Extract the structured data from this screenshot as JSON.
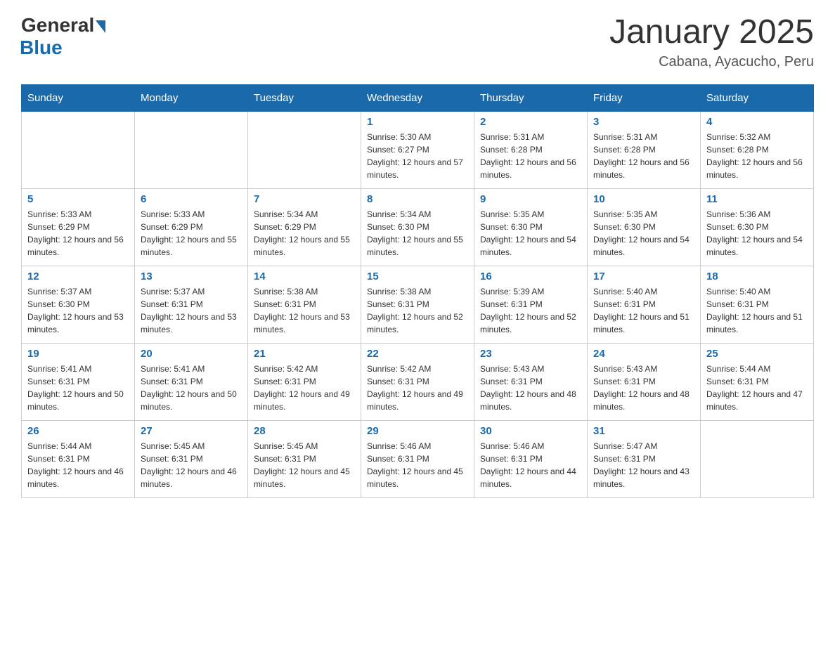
{
  "logo": {
    "general": "General",
    "blue": "Blue"
  },
  "title": "January 2025",
  "subtitle": "Cabana, Ayacucho, Peru",
  "days_of_week": [
    "Sunday",
    "Monday",
    "Tuesday",
    "Wednesday",
    "Thursday",
    "Friday",
    "Saturday"
  ],
  "weeks": [
    [
      {
        "day": "",
        "info": ""
      },
      {
        "day": "",
        "info": ""
      },
      {
        "day": "",
        "info": ""
      },
      {
        "day": "1",
        "info": "Sunrise: 5:30 AM\nSunset: 6:27 PM\nDaylight: 12 hours and 57 minutes."
      },
      {
        "day": "2",
        "info": "Sunrise: 5:31 AM\nSunset: 6:28 PM\nDaylight: 12 hours and 56 minutes."
      },
      {
        "day": "3",
        "info": "Sunrise: 5:31 AM\nSunset: 6:28 PM\nDaylight: 12 hours and 56 minutes."
      },
      {
        "day": "4",
        "info": "Sunrise: 5:32 AM\nSunset: 6:28 PM\nDaylight: 12 hours and 56 minutes."
      }
    ],
    [
      {
        "day": "5",
        "info": "Sunrise: 5:33 AM\nSunset: 6:29 PM\nDaylight: 12 hours and 56 minutes."
      },
      {
        "day": "6",
        "info": "Sunrise: 5:33 AM\nSunset: 6:29 PM\nDaylight: 12 hours and 55 minutes."
      },
      {
        "day": "7",
        "info": "Sunrise: 5:34 AM\nSunset: 6:29 PM\nDaylight: 12 hours and 55 minutes."
      },
      {
        "day": "8",
        "info": "Sunrise: 5:34 AM\nSunset: 6:30 PM\nDaylight: 12 hours and 55 minutes."
      },
      {
        "day": "9",
        "info": "Sunrise: 5:35 AM\nSunset: 6:30 PM\nDaylight: 12 hours and 54 minutes."
      },
      {
        "day": "10",
        "info": "Sunrise: 5:35 AM\nSunset: 6:30 PM\nDaylight: 12 hours and 54 minutes."
      },
      {
        "day": "11",
        "info": "Sunrise: 5:36 AM\nSunset: 6:30 PM\nDaylight: 12 hours and 54 minutes."
      }
    ],
    [
      {
        "day": "12",
        "info": "Sunrise: 5:37 AM\nSunset: 6:30 PM\nDaylight: 12 hours and 53 minutes."
      },
      {
        "day": "13",
        "info": "Sunrise: 5:37 AM\nSunset: 6:31 PM\nDaylight: 12 hours and 53 minutes."
      },
      {
        "day": "14",
        "info": "Sunrise: 5:38 AM\nSunset: 6:31 PM\nDaylight: 12 hours and 53 minutes."
      },
      {
        "day": "15",
        "info": "Sunrise: 5:38 AM\nSunset: 6:31 PM\nDaylight: 12 hours and 52 minutes."
      },
      {
        "day": "16",
        "info": "Sunrise: 5:39 AM\nSunset: 6:31 PM\nDaylight: 12 hours and 52 minutes."
      },
      {
        "day": "17",
        "info": "Sunrise: 5:40 AM\nSunset: 6:31 PM\nDaylight: 12 hours and 51 minutes."
      },
      {
        "day": "18",
        "info": "Sunrise: 5:40 AM\nSunset: 6:31 PM\nDaylight: 12 hours and 51 minutes."
      }
    ],
    [
      {
        "day": "19",
        "info": "Sunrise: 5:41 AM\nSunset: 6:31 PM\nDaylight: 12 hours and 50 minutes."
      },
      {
        "day": "20",
        "info": "Sunrise: 5:41 AM\nSunset: 6:31 PM\nDaylight: 12 hours and 50 minutes."
      },
      {
        "day": "21",
        "info": "Sunrise: 5:42 AM\nSunset: 6:31 PM\nDaylight: 12 hours and 49 minutes."
      },
      {
        "day": "22",
        "info": "Sunrise: 5:42 AM\nSunset: 6:31 PM\nDaylight: 12 hours and 49 minutes."
      },
      {
        "day": "23",
        "info": "Sunrise: 5:43 AM\nSunset: 6:31 PM\nDaylight: 12 hours and 48 minutes."
      },
      {
        "day": "24",
        "info": "Sunrise: 5:43 AM\nSunset: 6:31 PM\nDaylight: 12 hours and 48 minutes."
      },
      {
        "day": "25",
        "info": "Sunrise: 5:44 AM\nSunset: 6:31 PM\nDaylight: 12 hours and 47 minutes."
      }
    ],
    [
      {
        "day": "26",
        "info": "Sunrise: 5:44 AM\nSunset: 6:31 PM\nDaylight: 12 hours and 46 minutes."
      },
      {
        "day": "27",
        "info": "Sunrise: 5:45 AM\nSunset: 6:31 PM\nDaylight: 12 hours and 46 minutes."
      },
      {
        "day": "28",
        "info": "Sunrise: 5:45 AM\nSunset: 6:31 PM\nDaylight: 12 hours and 45 minutes."
      },
      {
        "day": "29",
        "info": "Sunrise: 5:46 AM\nSunset: 6:31 PM\nDaylight: 12 hours and 45 minutes."
      },
      {
        "day": "30",
        "info": "Sunrise: 5:46 AM\nSunset: 6:31 PM\nDaylight: 12 hours and 44 minutes."
      },
      {
        "day": "31",
        "info": "Sunrise: 5:47 AM\nSunset: 6:31 PM\nDaylight: 12 hours and 43 minutes."
      },
      {
        "day": "",
        "info": ""
      }
    ]
  ]
}
